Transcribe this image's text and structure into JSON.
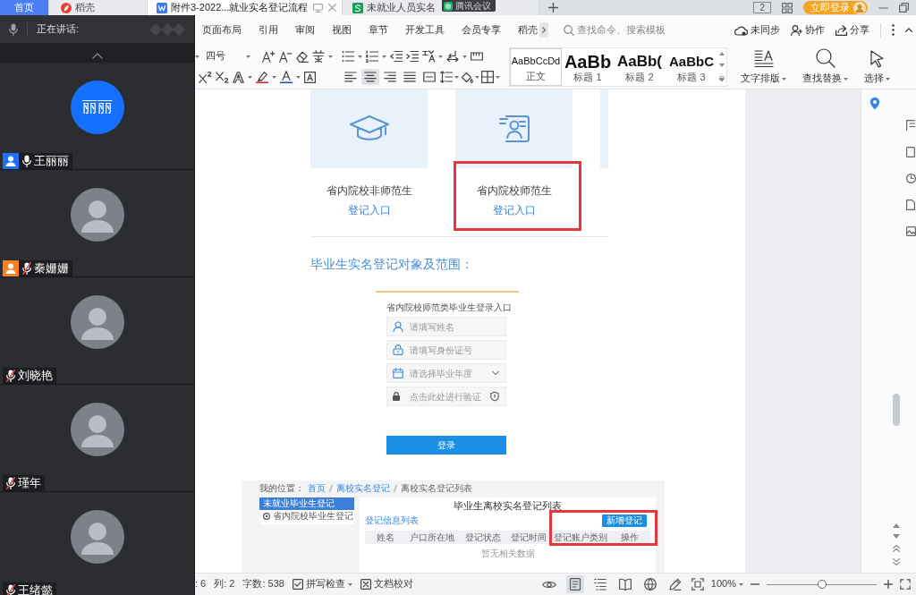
{
  "tabs": [
    {
      "label": "首页",
      "kind": "home",
      "selected": false
    },
    {
      "label": "稻壳",
      "kind": "docer",
      "selected": false
    },
    {
      "label": "附件3-2022...就业实名登记流程",
      "kind": "writer",
      "selected": true
    },
    {
      "label": "未就业人员实名",
      "kind": "sheet",
      "selected": false
    }
  ],
  "tooltip": {
    "label": "腾讯会议"
  },
  "title_bar": {
    "window_count": "2",
    "login": "立即登录"
  },
  "meeting": {
    "speaking_label": "正在讲话:",
    "participants": [
      {
        "name": "王丽丽",
        "kind": "initials",
        "initials": "丽丽",
        "color": "#1f6fff",
        "muted": false
      },
      {
        "name": "秦姗姗",
        "kind": "photo",
        "color": "#f5821f",
        "muted": true
      },
      {
        "name": "刘晓艳",
        "kind": "photo",
        "muted": true
      },
      {
        "name": "瑾年",
        "kind": "photo",
        "muted": true
      },
      {
        "name": "王绪懿",
        "kind": "photo",
        "muted": true
      }
    ]
  },
  "menu": {
    "items": [
      "页面布局",
      "引用",
      "审阅",
      "视图",
      "章节",
      "开发工具",
      "会员专享",
      "稻壳"
    ],
    "search": {
      "placeholder": "查找命令、搜索模板"
    },
    "actions": [
      {
        "kind": "sync",
        "label": "未同步"
      },
      {
        "kind": "collaborate",
        "label": "协作"
      },
      {
        "kind": "share",
        "label": "分享"
      }
    ]
  },
  "ribbon": {
    "font_size": "四号",
    "alignments": [
      {
        "kind": "left",
        "selected": false
      },
      {
        "kind": "center",
        "selected": true
      },
      {
        "kind": "right",
        "selected": false
      },
      {
        "kind": "justify",
        "selected": false
      },
      {
        "kind": "distributed",
        "selected": false
      }
    ],
    "styles": [
      {
        "sample": "AaBbCcDd",
        "label": "正文",
        "kind": "body",
        "selected": true
      },
      {
        "sample": "AaBb",
        "label": "标题 1",
        "kind": "h1",
        "selected": false
      },
      {
        "sample": "AaBb(",
        "label": "标题 2",
        "kind": "h2",
        "selected": false
      },
      {
        "sample": "AaBbC",
        "label": "标题 3",
        "kind": "h3",
        "selected": false
      }
    ],
    "tools": [
      {
        "kind": "layout",
        "label": "文字排版"
      },
      {
        "kind": "find",
        "label": "查找替换"
      },
      {
        "kind": "select",
        "label": "选择"
      }
    ]
  },
  "document": {
    "entry_cards": [
      {
        "kind": "cap",
        "label": "省内院校非师范生",
        "link": "登记入口",
        "highlighted": false
      },
      {
        "kind": "id",
        "label": "省内院校师范生",
        "link": "登记入口",
        "highlighted": true
      }
    ],
    "heading": "毕业生实名登记对象及范围：",
    "login_form": {
      "title": "省内院校师范类毕业生登录入口",
      "fields": [
        {
          "kind": "name",
          "placeholder": "请填写姓名"
        },
        {
          "kind": "id",
          "placeholder": "请填写身份证号"
        },
        {
          "kind": "year",
          "placeholder": "请选择毕业年度"
        },
        {
          "kind": "captcha",
          "placeholder": "点击此处进行验证"
        }
      ],
      "submit": "登录"
    },
    "list_page": {
      "breadcrumb_label": "我的位置：",
      "breadcrumb": [
        "首页",
        "离校实名登记",
        "离校实名登记列表"
      ],
      "side_items": [
        {
          "label": "未就业毕业生登记",
          "selected": true
        },
        {
          "label": "省内院校毕业生登记",
          "selected": false
        }
      ],
      "title": "毕业生离校实名登记列表",
      "section": "登记信息列表",
      "add_button": {
        "label": "新增登记",
        "highlighted": true
      },
      "columns": [
        "姓名",
        "户口所在地",
        "登记状态",
        "登记时间",
        "登记账户类别",
        "操作"
      ],
      "empty_text": "暂无相关数据"
    }
  },
  "status_bar": {
    "items": [
      ": 6",
      "列: 2",
      "字数: 538"
    ],
    "spell_check": "拼写检查",
    "proofread": "文档校对",
    "views": [
      {
        "kind": "eye",
        "selected": false
      },
      {
        "kind": "page",
        "selected": true
      },
      {
        "kind": "outline",
        "selected": false
      },
      {
        "kind": "read",
        "selected": false
      },
      {
        "kind": "web",
        "selected": false
      },
      {
        "kind": "write",
        "selected": false
      }
    ],
    "zoom": {
      "reading": "100%",
      "level": 0.5
    }
  }
}
